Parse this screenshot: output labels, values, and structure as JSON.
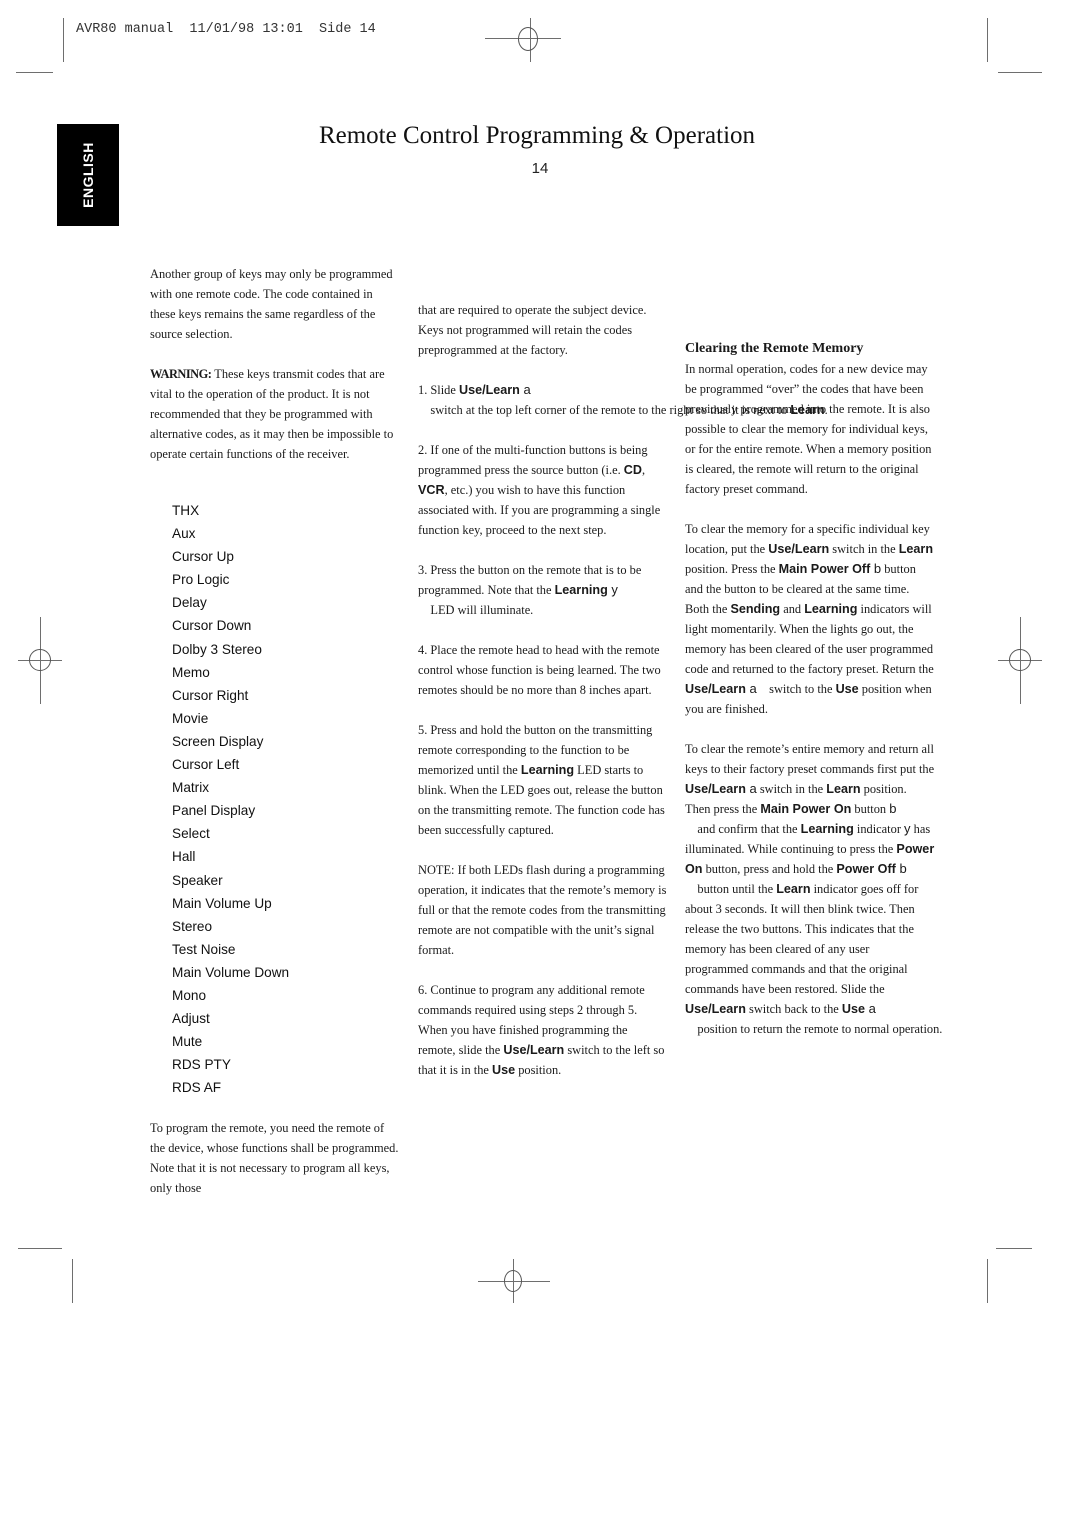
{
  "slug": "AVR80 manual  11/01/98 13:01  Side 14",
  "language_tab": "ENGLISH",
  "page": {
    "title": "Remote Control Programming & Operation",
    "number": "14"
  },
  "col1": {
    "intro": "Another group of keys may only be programmed with one remote code. The code contained in these keys remains the same regardless of the source selection.",
    "warning_label": "WARNING:",
    "warning_text": " These keys transmit codes that are vital to the operation of the product. It is not recommended that they be programmed with alternative codes, as it may then be impossible to operate certain functions of the receiver.",
    "keys": [
      "THX",
      "Aux",
      "Cursor Up",
      "Pro Logic",
      "Delay",
      "Cursor Down",
      "Dolby 3 Stereo",
      "Memo",
      "Cursor Right",
      "Movie",
      "Screen Display",
      "Cursor Left",
      "Matrix",
      "Panel Display",
      "Select",
      "Hall",
      "Speaker",
      "Main Volume Up",
      "Stereo",
      "Test Noise",
      "Main Volume Down",
      "Mono",
      "Adjust",
      "Mute",
      "RDS PTY",
      "RDS AF"
    ],
    "outro": "To program the remote, you need the remote of the device, whose functions shall be programmed. Note that it is not necessary to program all keys, only those"
  },
  "col2": {
    "cont": "that are required to operate the subject device. Keys not programmed will retain the codes preprogrammed at the factory.",
    "step1": {
      "a": "1. Slide ",
      "b1": "Use/Learn",
      "sym": " a",
      "c": "    switch at the top left corner of the remote to the right so that it is next to ",
      "b2": "Learn",
      "d": "."
    },
    "step2": {
      "a": "2. If one of the multi-function buttons is being programmed press the source button (i.e. ",
      "b1": "CD",
      "c": ", ",
      "b2": "VCR",
      "d": ", etc.) you wish to have this function associated with. If you are programming a single function key, proceed to the next step."
    },
    "step3": {
      "a": "3. Press the button on the remote that is to be programmed. Note that the ",
      "b1": "Learning",
      "sym": " y",
      "c": "    LED will illuminate."
    },
    "step4": "4. Place the remote head to head with the remote control whose function is being learned. The two remotes should be no more than 8 inches apart.",
    "step5": {
      "a": "5. Press and hold the button on the transmitting remote corresponding to the function to be memorized until the ",
      "b1": "Learning",
      "c": " LED starts to blink. When the LED goes out, release the button on the transmitting remote. The function code has been successfully captured."
    },
    "note": "NOTE: If both LEDs flash during a programming operation, it indicates that the remote’s memory is full or that the remote codes from the transmitting remote are not compatible with the unit’s signal format.",
    "step6": {
      "a": "6. Continue to program any additional remote commands required using steps 2 through 5. When you have finished programming the remote, slide the ",
      "b1": "Use/Learn",
      "c": " switch to the left so that it is in the ",
      "b2": "Use",
      "d": " position."
    }
  },
  "col3": {
    "heading": "Clearing the Remote Memory",
    "intro": "In normal operation, codes for a new device may be programmed “over” the codes that have been previously programmed into the remote. It is also possible to clear the memory for individual keys, or for the entire remote. When a memory position is cleared, the remote will return to the original factory preset command.",
    "p2": {
      "t1": "To clear the memory for a specific individual key location, put the ",
      "b1": "Use/Learn",
      "t2": " switch in the ",
      "b2": "Learn",
      "t3": " position. Press the ",
      "b3": "Main Power Off",
      "s1": " b",
      "t4": " button and the button to be cleared at the same time. Both the ",
      "b4": "Sending",
      "t5": " and ",
      "b5": "Learning",
      "t6": " indicators will light momentarily. When the lights go out, the memory has been cleared of the user programmed code and returned to the factory preset. Return the ",
      "b6": "Use/Learn",
      "s2": " a",
      "t7": "    switch to the ",
      "b7": "Use",
      "t8": " position when you are finished."
    },
    "p3": {
      "t1": "To clear the remote’s entire memory and return all keys to their factory preset commands first put the ",
      "b1": "Use/Learn",
      "s1": " a",
      "t2": " switch in the ",
      "b2": "Learn",
      "t3": " position. Then press the ",
      "b3": "Main Power On",
      "t4": " button ",
      "s2": "b",
      "t5": "    and confirm that the ",
      "b4": "Learning",
      "t6": " indicator ",
      "s3": "y",
      "t7": " has illuminated. While continuing to press the ",
      "b5": "Power On",
      "t8": " button, press and hold the ",
      "b6": "Power Off",
      "s4": " b",
      "t9": "    button until the ",
      "b7": "Learn",
      "t10": " indicator goes off for about 3 seconds. It will then blink twice. Then release the two buttons. This indicates that the memory has been cleared of any user programmed commands and that the original commands have been restored. Slide the ",
      "b8": "Use/Learn",
      "t11": " switch back to the ",
      "b9": "Use",
      "s5": " a",
      "t12": "    position to return the remote to normal operation."
    }
  }
}
